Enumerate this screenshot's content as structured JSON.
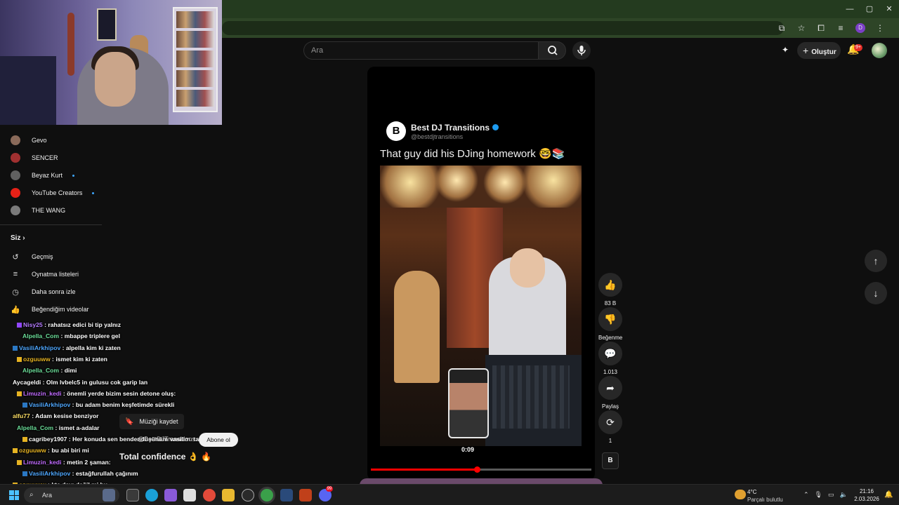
{
  "browser": {
    "controls": {
      "minimize": "—",
      "maximize": "▢",
      "close": "✕"
    }
  },
  "header": {
    "search_placeholder": "Ara",
    "create_label": "Oluştur",
    "notification_count": "9+"
  },
  "sidebar": {
    "subscriptions": [
      {
        "label": "Gevo",
        "avatar_color": "#8a6a5a",
        "live": false
      },
      {
        "label": "SENCER",
        "avatar_color": "#a03030",
        "live": false
      },
      {
        "label": "Beyaz Kurt",
        "avatar_color": "#606060",
        "live": true
      },
      {
        "label": "YouTube Creators",
        "avatar_color": "#e62117",
        "live": true
      },
      {
        "label": "THE WANG",
        "avatar_color": "#7a7a7a",
        "live": false
      }
    ],
    "you_section": "Siz",
    "you_items": [
      {
        "label": "Geçmiş",
        "icon": "history-icon"
      },
      {
        "label": "Oynatma listeleri",
        "icon": "playlist-icon"
      },
      {
        "label": "Daha sonra izle",
        "icon": "clock-icon"
      },
      {
        "label": "Beğendiğim videolar",
        "icon": "like-icon"
      }
    ]
  },
  "chat": {
    "lines": [
      {
        "user": "Nisy25",
        "user_color": "#b57cff",
        "badge": "p",
        "text": "rahatsız edici bi tip yalnız"
      },
      {
        "user": "Alpella_Com",
        "user_color": "#6cdf9a",
        "badge": "",
        "text": "mbappe triplere gel"
      },
      {
        "user": "VasiliArkhipov",
        "user_color": "#4fa8ff",
        "badge": "b",
        "text": "alpella kim ki zaten"
      },
      {
        "user": "ozguuww",
        "user_color": "#e6b322",
        "badge": "y",
        "text": "ismet kim ki zaten"
      },
      {
        "user": "Alpella_Com",
        "user_color": "#6cdf9a",
        "badge": "",
        "text": "dimi"
      },
      {
        "user": "Aycageldi",
        "user_color": "#ffffff",
        "badge": "",
        "text": "Olm lvbelc5 in gulusu cok garip lan"
      },
      {
        "user": "Limuzin_kedi",
        "user_color": "#c06bff",
        "badge": "y",
        "text": "önemli yerde bizim sesin detone oluş:"
      },
      {
        "user": "VasiliArkhipov",
        "user_color": "#4fa8ff",
        "badge": "b",
        "text": "bu adam benim keşfetimde sürekli"
      },
      {
        "user": "alfu77",
        "user_color": "#ffe066",
        "badge": "",
        "text": "Adam kesise benziyor"
      },
      {
        "user": "Alpella_Com",
        "user_color": "#6cdf9a",
        "badge": "",
        "text": "ismet a-adalar"
      },
      {
        "user": "cagribey1907",
        "user_color": "#ffffff",
        "badge": "y",
        "text": "Her konuda sen bendendüşünüm vasilim. ta"
      },
      {
        "user": "ozguuww",
        "user_color": "#e6b322",
        "badge": "y",
        "text": "bu abi biri mi"
      },
      {
        "user": "Limuzin_kedi",
        "user_color": "#c06bff",
        "badge": "y",
        "text": "metin 2 şaman:"
      },
      {
        "user": "VasiliArkhipov",
        "user_color": "#4fa8ff",
        "badge": "b",
        "text": "estağfurullah çağınım"
      },
      {
        "user": "ozguuww",
        "user_color": "#e6b322",
        "badge": "y",
        "text": "ktc dayı değil mi bu"
      }
    ]
  },
  "short": {
    "save_music": "Müziği kaydet",
    "channel_handle": "@BestDJTransitions",
    "subscribe": "Abone ol",
    "title": "Total confidence 👌 🔥",
    "tweet_name": "Best DJ Transitions",
    "tweet_handle": "@bestdjtransitions",
    "tweet_caption": "That guy did his DJing homework 🤓📚",
    "logo_letter": "B",
    "timecode": "0:09",
    "progress": 0.48
  },
  "actions": {
    "likes": "83 B",
    "dislike": "Beğenme",
    "comments": "1.013",
    "share": "Paylaş",
    "remix": "1"
  },
  "taskbar": {
    "search": "Ara",
    "weather_temp": "4°C",
    "weather_desc": "Parçalı bulutlu",
    "time": "21:16",
    "date": "2.03.2026",
    "mail_badge": "99",
    "weather_badge": "1"
  }
}
